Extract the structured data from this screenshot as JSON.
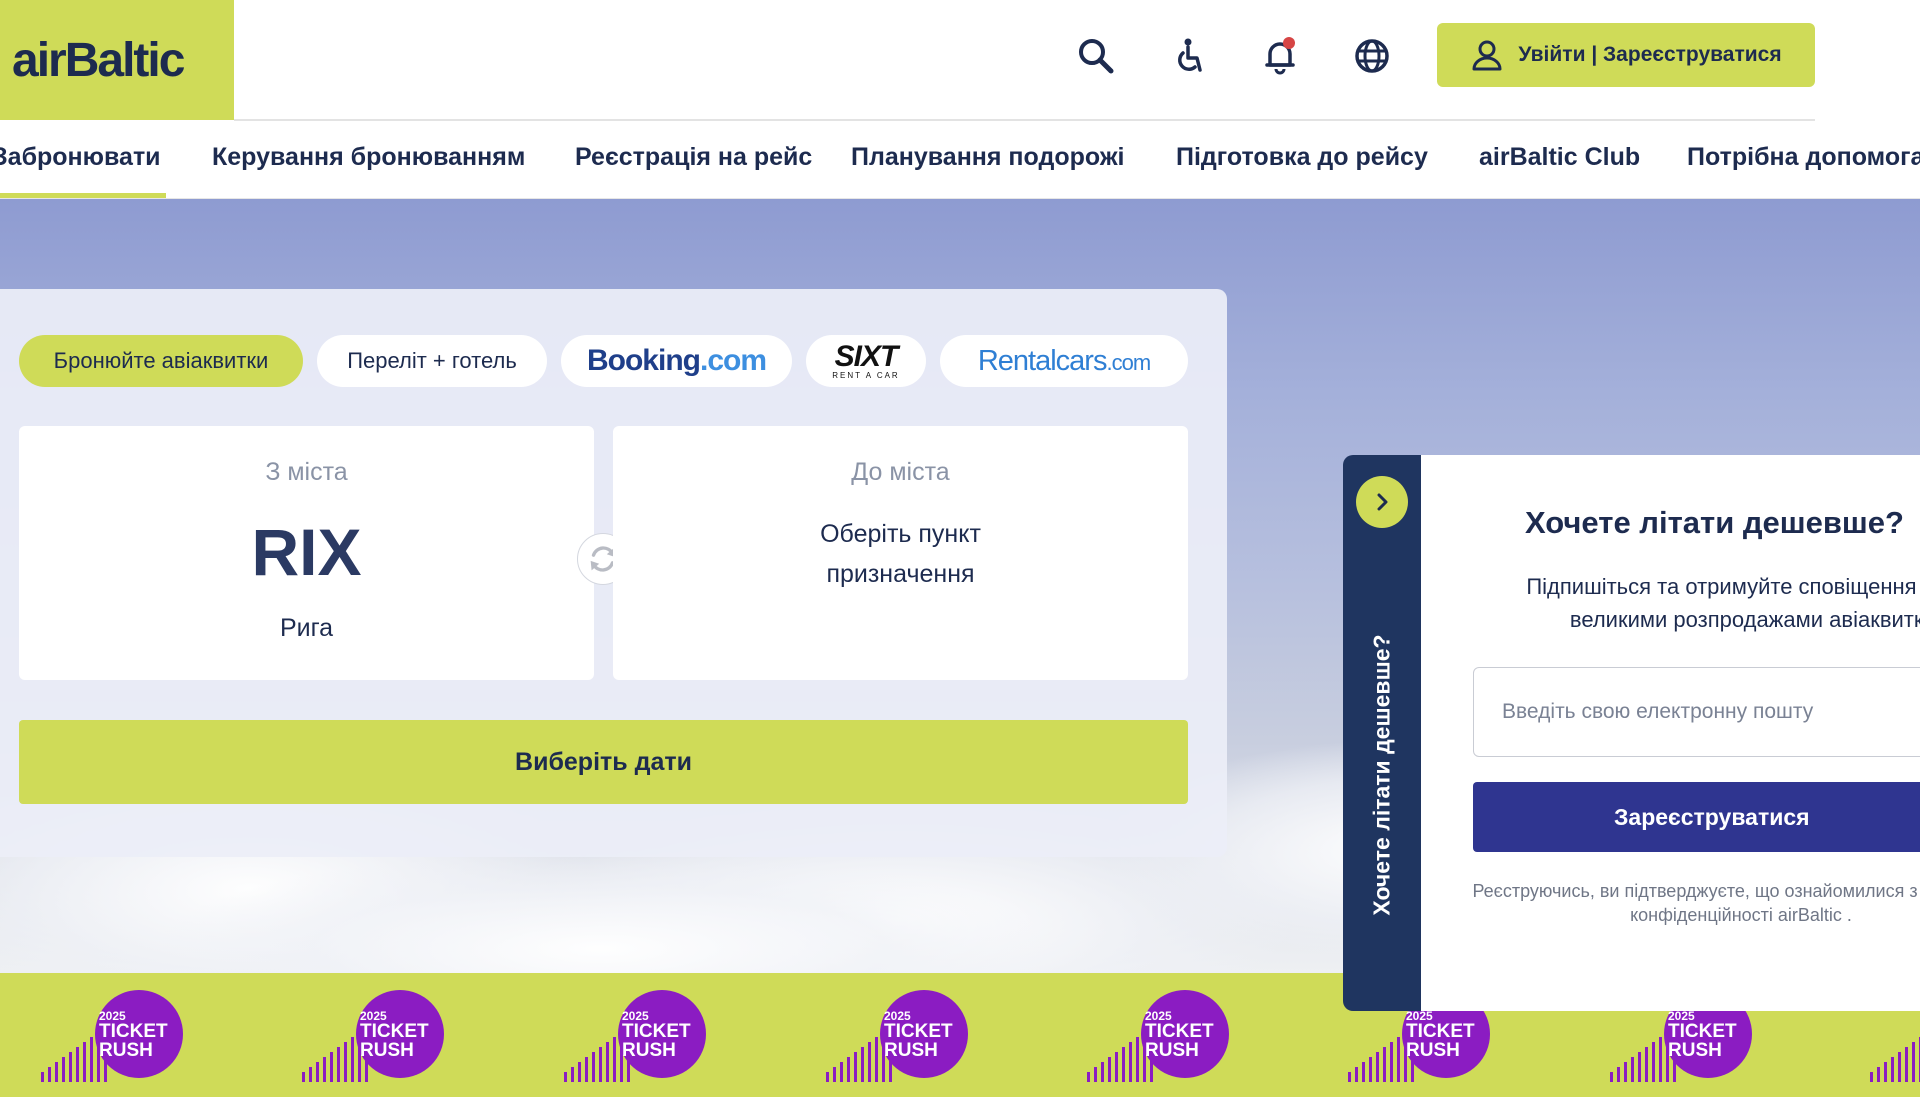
{
  "header": {
    "logo": "airBaltic",
    "login_label": "Увійти | Зареєструватися",
    "icons": [
      "search-icon",
      "accessibility-icon",
      "notification-bell-icon",
      "globe-icon",
      "user-icon"
    ]
  },
  "nav": {
    "items": [
      {
        "label": "Забронювати",
        "active": true
      },
      {
        "label": "Керування бронюванням"
      },
      {
        "label": "Реєстрація на рейс"
      },
      {
        "label": "Планування подорожі"
      },
      {
        "label": "Підготовка до рейсу"
      },
      {
        "label": "airBaltic Club"
      },
      {
        "label": "Потрібна допомога"
      }
    ]
  },
  "booking": {
    "tabs": {
      "flights": "Бронюйте авіаквитки",
      "flight_hotel": "Переліт + готель",
      "booking_a": "Booking",
      "booking_b": ".com",
      "sixt_a": "SIXT",
      "sixt_b": "RENT A CAR",
      "rental_a": "Rentalcars",
      "rental_b": ".com"
    },
    "from": {
      "label": "З міста",
      "code": "RIX",
      "city": "Рига"
    },
    "to": {
      "label": "До міста",
      "placeholder": "Оберіть пункт призначення"
    },
    "dates_button": "Виберіть дати"
  },
  "promo": {
    "year": "2025",
    "line1": "TICKET",
    "line2": "RUSH"
  },
  "subscribe": {
    "tab_label": "Хочете літати дешевше?",
    "title": "Хочете літати дешевше?",
    "description": "Підпишіться та отримуйте сповіщення перед великими розпродажами авіаквитків",
    "email_placeholder": "Введіть свою електронну пошту",
    "button": "Зареєструватися",
    "legal": "Реєструючись, ви підтверджуєте, що ознайомилися з Політикою конфіденційності airBaltic ."
  },
  "colors": {
    "brand_lime": "#cfdb58",
    "brand_navy": "#1d2b4f",
    "promo_purple": "#8b1cc2",
    "subscribe_button": "#2f3590"
  }
}
